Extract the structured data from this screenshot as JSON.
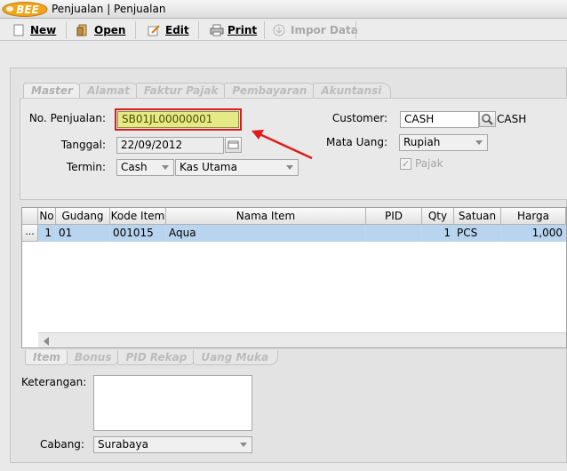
{
  "window": {
    "logo_text": "BEE",
    "title": "Penjualan | Penjualan"
  },
  "toolbar": {
    "new": "New",
    "open": "Open",
    "edit": "Edit",
    "print": "Print",
    "import": "Impor Data"
  },
  "tabs_top": [
    "Master",
    "Alamat",
    "Faktur Pajak",
    "Pembayaran",
    "Akuntansi"
  ],
  "form": {
    "no_penjualan_label": "No. Penjualan:",
    "no_penjualan": "SB01JL00000001",
    "tanggal_label": "Tanggal:",
    "tanggal": "22/09/2012",
    "termin_label": "Termin:",
    "termin": "Cash",
    "kas": "Kas Utama",
    "customer_label": "Customer:",
    "customer": "CASH",
    "customer_name": "CASH",
    "mata_uang_label": "Mata Uang:",
    "mata_uang": "Rupiah",
    "pajak_label": "Pajak"
  },
  "grid": {
    "columns": [
      "No",
      "Gudang",
      "Kode Item",
      "Nama Item",
      "PID",
      "Qty",
      "Satuan",
      "Harga"
    ],
    "rows": [
      {
        "rowhdr": "...",
        "no": "1",
        "gudang": "01",
        "kode": "001015",
        "nama": "Aqua",
        "pid": "",
        "qty": "1",
        "satuan": "PCS",
        "harga": "1,000"
      }
    ]
  },
  "tabs_bottom": [
    "Item",
    "Bonus",
    "PID Rekap",
    "Uang Muka"
  ],
  "footer": {
    "keterangan_label": "Keterangan:",
    "keterangan": "",
    "cabang_label": "Cabang:",
    "cabang": "Surabaya"
  },
  "colors": {
    "highlight_field": "#e6ea86",
    "annotation_red": "#e01b1b",
    "selected_row": "#b9d4ee"
  }
}
